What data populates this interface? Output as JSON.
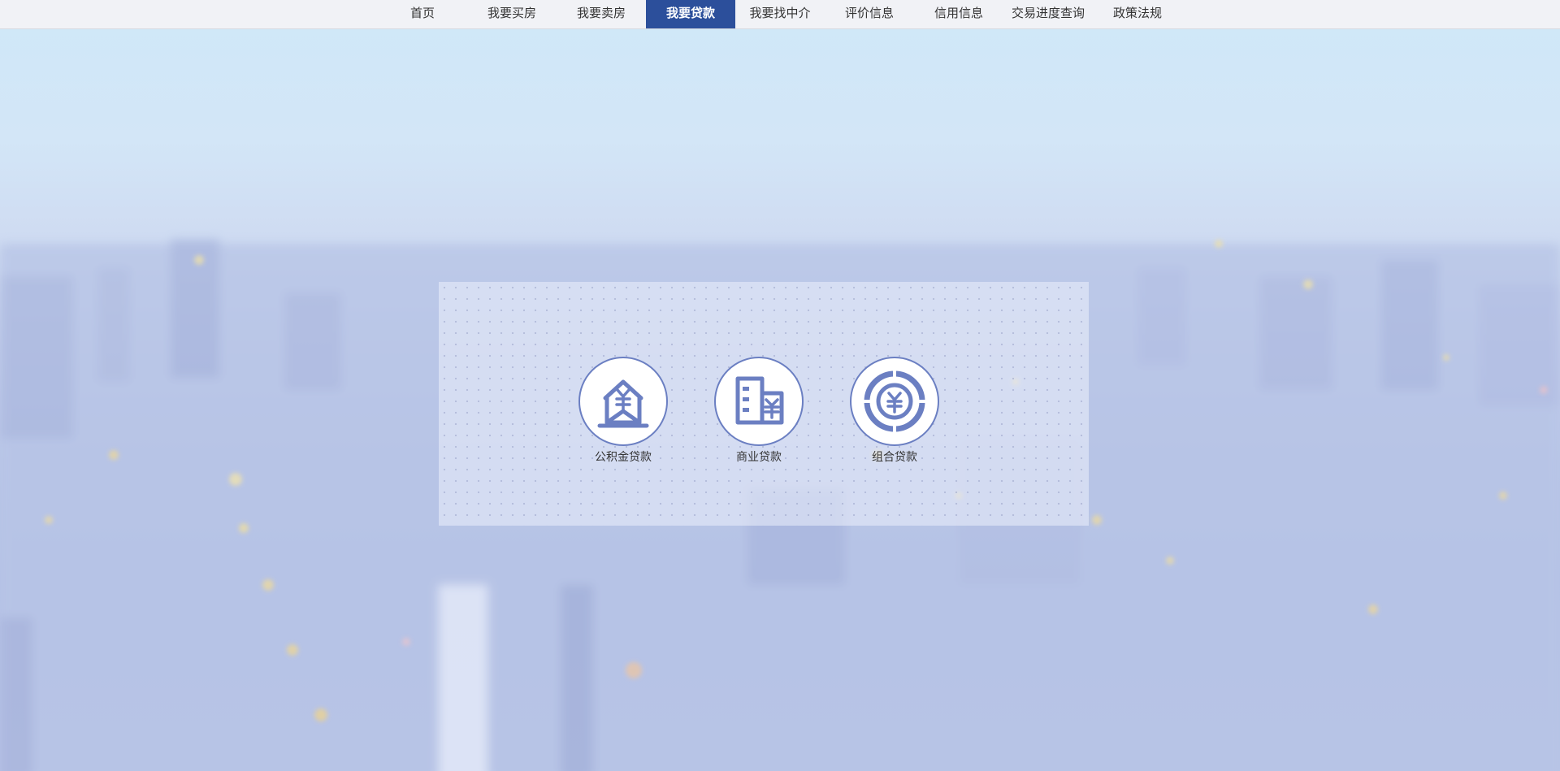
{
  "nav": {
    "items": [
      {
        "label": "首页",
        "active": false
      },
      {
        "label": "我要买房",
        "active": false
      },
      {
        "label": "我要卖房",
        "active": false
      },
      {
        "label": "我要贷款",
        "active": true
      },
      {
        "label": "我要找中介",
        "active": false
      },
      {
        "label": "评价信息",
        "active": false
      },
      {
        "label": "信用信息",
        "active": false
      },
      {
        "label": "交易进度查询",
        "active": false
      },
      {
        "label": "政策法规",
        "active": false
      }
    ],
    "active_color": "#2c4f9b"
  },
  "loan_options": [
    {
      "label": "公积金贷款",
      "icon": "provident-fund-house-icon"
    },
    {
      "label": "商业贷款",
      "icon": "commercial-building-icon"
    },
    {
      "label": "组合贷款",
      "icon": "yuan-coin-icon"
    }
  ],
  "colors": {
    "icon": "#6b7fc2",
    "nav_background": "#f1f2f6"
  }
}
